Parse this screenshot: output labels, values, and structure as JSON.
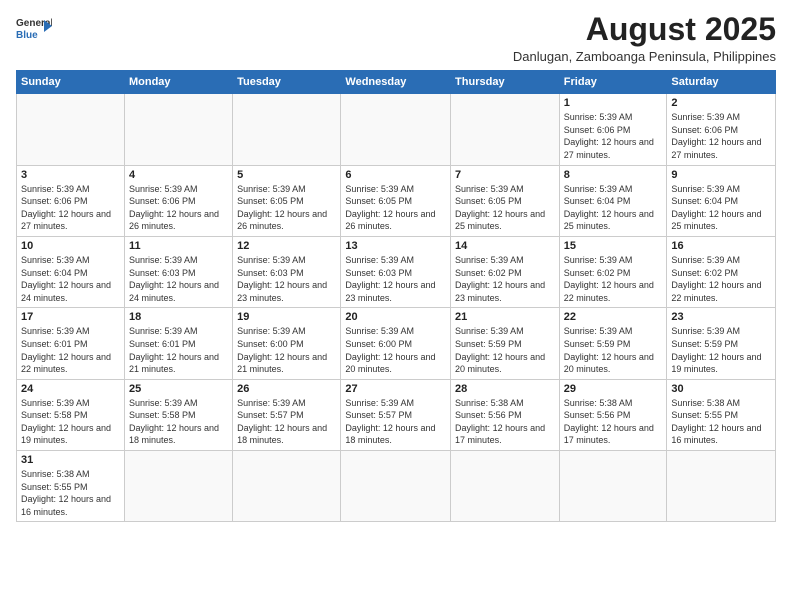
{
  "header": {
    "logo_general": "General",
    "logo_blue": "Blue",
    "title": "August 2025",
    "subtitle": "Danlugan, Zamboanga Peninsula, Philippines"
  },
  "days_of_week": [
    "Sunday",
    "Monday",
    "Tuesday",
    "Wednesday",
    "Thursday",
    "Friday",
    "Saturday"
  ],
  "weeks": [
    [
      {
        "day": "",
        "info": ""
      },
      {
        "day": "",
        "info": ""
      },
      {
        "day": "",
        "info": ""
      },
      {
        "day": "",
        "info": ""
      },
      {
        "day": "",
        "info": ""
      },
      {
        "day": "1",
        "info": "Sunrise: 5:39 AM\nSunset: 6:06 PM\nDaylight: 12 hours and 27 minutes."
      },
      {
        "day": "2",
        "info": "Sunrise: 5:39 AM\nSunset: 6:06 PM\nDaylight: 12 hours and 27 minutes."
      }
    ],
    [
      {
        "day": "3",
        "info": "Sunrise: 5:39 AM\nSunset: 6:06 PM\nDaylight: 12 hours and 27 minutes."
      },
      {
        "day": "4",
        "info": "Sunrise: 5:39 AM\nSunset: 6:06 PM\nDaylight: 12 hours and 26 minutes."
      },
      {
        "day": "5",
        "info": "Sunrise: 5:39 AM\nSunset: 6:05 PM\nDaylight: 12 hours and 26 minutes."
      },
      {
        "day": "6",
        "info": "Sunrise: 5:39 AM\nSunset: 6:05 PM\nDaylight: 12 hours and 26 minutes."
      },
      {
        "day": "7",
        "info": "Sunrise: 5:39 AM\nSunset: 6:05 PM\nDaylight: 12 hours and 25 minutes."
      },
      {
        "day": "8",
        "info": "Sunrise: 5:39 AM\nSunset: 6:04 PM\nDaylight: 12 hours and 25 minutes."
      },
      {
        "day": "9",
        "info": "Sunrise: 5:39 AM\nSunset: 6:04 PM\nDaylight: 12 hours and 25 minutes."
      }
    ],
    [
      {
        "day": "10",
        "info": "Sunrise: 5:39 AM\nSunset: 6:04 PM\nDaylight: 12 hours and 24 minutes."
      },
      {
        "day": "11",
        "info": "Sunrise: 5:39 AM\nSunset: 6:03 PM\nDaylight: 12 hours and 24 minutes."
      },
      {
        "day": "12",
        "info": "Sunrise: 5:39 AM\nSunset: 6:03 PM\nDaylight: 12 hours and 23 minutes."
      },
      {
        "day": "13",
        "info": "Sunrise: 5:39 AM\nSunset: 6:03 PM\nDaylight: 12 hours and 23 minutes."
      },
      {
        "day": "14",
        "info": "Sunrise: 5:39 AM\nSunset: 6:02 PM\nDaylight: 12 hours and 23 minutes."
      },
      {
        "day": "15",
        "info": "Sunrise: 5:39 AM\nSunset: 6:02 PM\nDaylight: 12 hours and 22 minutes."
      },
      {
        "day": "16",
        "info": "Sunrise: 5:39 AM\nSunset: 6:02 PM\nDaylight: 12 hours and 22 minutes."
      }
    ],
    [
      {
        "day": "17",
        "info": "Sunrise: 5:39 AM\nSunset: 6:01 PM\nDaylight: 12 hours and 22 minutes."
      },
      {
        "day": "18",
        "info": "Sunrise: 5:39 AM\nSunset: 6:01 PM\nDaylight: 12 hours and 21 minutes."
      },
      {
        "day": "19",
        "info": "Sunrise: 5:39 AM\nSunset: 6:00 PM\nDaylight: 12 hours and 21 minutes."
      },
      {
        "day": "20",
        "info": "Sunrise: 5:39 AM\nSunset: 6:00 PM\nDaylight: 12 hours and 20 minutes."
      },
      {
        "day": "21",
        "info": "Sunrise: 5:39 AM\nSunset: 5:59 PM\nDaylight: 12 hours and 20 minutes."
      },
      {
        "day": "22",
        "info": "Sunrise: 5:39 AM\nSunset: 5:59 PM\nDaylight: 12 hours and 20 minutes."
      },
      {
        "day": "23",
        "info": "Sunrise: 5:39 AM\nSunset: 5:59 PM\nDaylight: 12 hours and 19 minutes."
      }
    ],
    [
      {
        "day": "24",
        "info": "Sunrise: 5:39 AM\nSunset: 5:58 PM\nDaylight: 12 hours and 19 minutes."
      },
      {
        "day": "25",
        "info": "Sunrise: 5:39 AM\nSunset: 5:58 PM\nDaylight: 12 hours and 18 minutes."
      },
      {
        "day": "26",
        "info": "Sunrise: 5:39 AM\nSunset: 5:57 PM\nDaylight: 12 hours and 18 minutes."
      },
      {
        "day": "27",
        "info": "Sunrise: 5:39 AM\nSunset: 5:57 PM\nDaylight: 12 hours and 18 minutes."
      },
      {
        "day": "28",
        "info": "Sunrise: 5:38 AM\nSunset: 5:56 PM\nDaylight: 12 hours and 17 minutes."
      },
      {
        "day": "29",
        "info": "Sunrise: 5:38 AM\nSunset: 5:56 PM\nDaylight: 12 hours and 17 minutes."
      },
      {
        "day": "30",
        "info": "Sunrise: 5:38 AM\nSunset: 5:55 PM\nDaylight: 12 hours and 16 minutes."
      }
    ],
    [
      {
        "day": "31",
        "info": "Sunrise: 5:38 AM\nSunset: 5:55 PM\nDaylight: 12 hours and 16 minutes."
      },
      {
        "day": "",
        "info": ""
      },
      {
        "day": "",
        "info": ""
      },
      {
        "day": "",
        "info": ""
      },
      {
        "day": "",
        "info": ""
      },
      {
        "day": "",
        "info": ""
      },
      {
        "day": "",
        "info": ""
      }
    ]
  ]
}
